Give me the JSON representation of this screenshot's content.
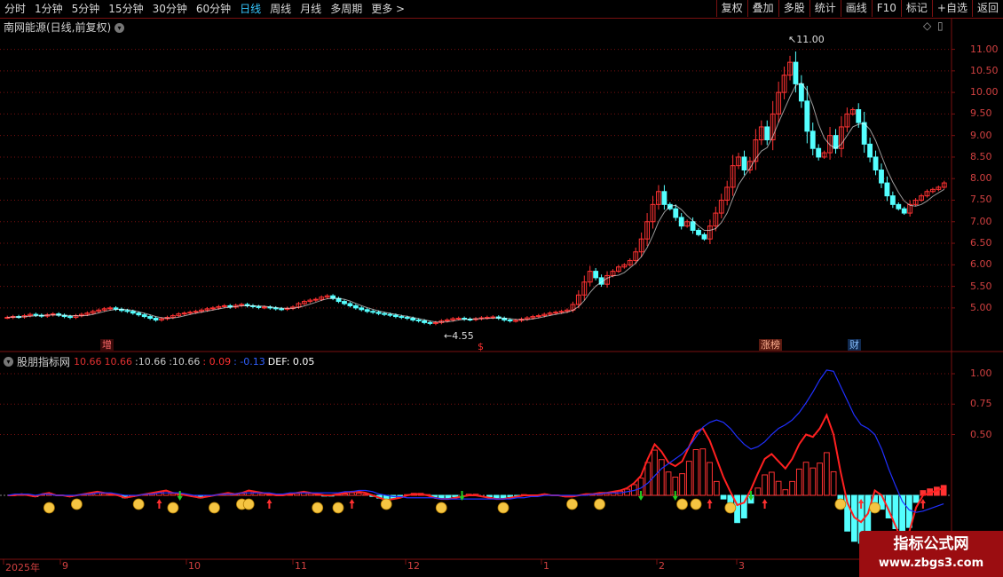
{
  "toolbar": {
    "periods": [
      "分时",
      "1分钟",
      "5分钟",
      "15分钟",
      "30分钟",
      "60分钟",
      "日线",
      "周线",
      "月线",
      "多周期",
      "更多 >"
    ],
    "active": "日线",
    "right": [
      "复权",
      "叠加",
      "多股",
      "统计",
      "画线",
      "F10",
      "标记",
      "+自选",
      "返回"
    ]
  },
  "main_panel": {
    "title": "南网能源(日线,前复权)",
    "high_label": "11.00",
    "low_label": "4.55",
    "tags": [
      {
        "text": "增",
        "color": "#ff5555"
      },
      {
        "text": "$",
        "color": "#ff3333"
      },
      {
        "text": "涨榜",
        "color": "#ff8a6a"
      },
      {
        "text": "财",
        "color": "#66aaff"
      }
    ]
  },
  "indicator_panel": {
    "title": "股朋指标网",
    "values": [
      "10.66",
      "10.66",
      ":10.66",
      ":10.66",
      ": 0.09",
      ": -0.13",
      "DEF: 0.05"
    ],
    "value_colors": [
      "#e03030",
      "#e03030",
      "#c8c8c8",
      "#c8c8c8",
      "#ff3030",
      "#3060ff",
      "#ffffff"
    ]
  },
  "watermark": {
    "title": "指标公式网",
    "url": "www.zbgs3.com"
  },
  "colors": {
    "up": "#ff3232",
    "down": "#54ffff",
    "grid": "#7a1010",
    "ma": "#ffffff"
  },
  "chart_data": [
    {
      "type": "candlestick",
      "title": "南网能源(日线,前复权)",
      "y_ticks": [
        11.0,
        10.5,
        10.0,
        9.5,
        9.0,
        8.5,
        8.0,
        7.5,
        7.0,
        6.5,
        6.0,
        5.5,
        5.0
      ],
      "ylim": [
        4.4,
        11.3
      ],
      "x_ticks": [
        "2025年",
        "9",
        "10",
        "11",
        "12",
        "1",
        "2",
        "3"
      ],
      "close": [
        4.78,
        4.8,
        4.79,
        4.82,
        4.85,
        4.83,
        4.81,
        4.84,
        4.86,
        4.83,
        4.8,
        4.78,
        4.82,
        4.85,
        4.88,
        4.92,
        4.95,
        4.98,
        5.0,
        4.97,
        4.94,
        4.92,
        4.88,
        4.84,
        4.8,
        4.76,
        4.72,
        4.75,
        4.78,
        4.82,
        4.86,
        4.88,
        4.9,
        4.92,
        4.95,
        4.98,
        5.0,
        5.03,
        5.05,
        5.02,
        5.06,
        5.08,
        5.05,
        5.03,
        5.01,
        5.02,
        5.0,
        4.98,
        4.97,
        4.99,
        5.02,
        5.1,
        5.15,
        5.18,
        5.2,
        5.25,
        5.28,
        5.22,
        5.15,
        5.1,
        5.05,
        5.0,
        4.96,
        4.92,
        4.9,
        4.87,
        4.85,
        4.83,
        4.8,
        4.78,
        4.76,
        4.72,
        4.7,
        4.66,
        4.64,
        4.66,
        4.7,
        4.72,
        4.75,
        4.76,
        4.74,
        4.73,
        4.75,
        4.77,
        4.78,
        4.79,
        4.76,
        4.72,
        4.7,
        4.71,
        4.74,
        4.77,
        4.8,
        4.82,
        4.85,
        4.88,
        4.9,
        4.92,
        4.95,
        5.08,
        5.3,
        5.6,
        5.85,
        5.7,
        5.55,
        5.75,
        5.85,
        5.95,
        6.0,
        6.1,
        6.3,
        6.6,
        7.0,
        7.4,
        7.7,
        7.4,
        7.3,
        7.1,
        6.9,
        7.0,
        6.8,
        6.7,
        6.6,
        6.9,
        7.2,
        7.5,
        7.8,
        8.3,
        8.5,
        8.2,
        8.4,
        8.9,
        9.2,
        8.9,
        9.5,
        10.0,
        10.4,
        10.7,
        10.2,
        9.8,
        9.1,
        8.7,
        8.5,
        8.6,
        9.0,
        8.7,
        9.2,
        9.5,
        9.6,
        9.3,
        8.8,
        8.5,
        8.2,
        7.9,
        7.6,
        7.4,
        7.3,
        7.2,
        7.4,
        7.5,
        7.6,
        7.7,
        7.75,
        7.8,
        7.9
      ]
    },
    {
      "type": "indicator",
      "title": "股朋指标网",
      "y_ticks": [
        1.0,
        0.75,
        0.5
      ],
      "series": [
        {
          "color": "#ff2020",
          "values": [
            0.0,
            0.0,
            0.01,
            0.0,
            -0.01,
            0.01,
            0.02,
            0.0,
            0.0,
            -0.01,
            0.0,
            0.01,
            0.02,
            0.03,
            0.02,
            0.01,
            0.0,
            -0.02,
            -0.01,
            0.0,
            0.01,
            0.02,
            0.03,
            0.04,
            0.02,
            0.01,
            0.0,
            -0.01,
            -0.02,
            -0.01,
            0.0,
            0.01,
            0.02,
            0.01,
            0.02,
            0.04,
            0.03,
            0.02,
            0.01,
            0.0,
            0.0,
            0.01,
            0.02,
            0.03,
            0.02,
            0.01,
            0.0,
            0.0,
            0.01,
            0.02,
            0.03,
            0.03,
            0.02,
            0.0,
            -0.02,
            -0.04,
            -0.03,
            -0.02,
            0.0,
            0.01,
            0.01,
            0.0,
            -0.02,
            -0.03,
            -0.03,
            -0.02,
            -0.01,
            0.0,
            0.0,
            -0.01,
            -0.02,
            -0.03,
            -0.03,
            -0.02,
            -0.01,
            0.0,
            0.0,
            0.0,
            0.01,
            0.0,
            0.0,
            -0.01,
            -0.01,
            0.0,
            0.01,
            0.01,
            0.02,
            0.02,
            0.03,
            0.04,
            0.06,
            0.1,
            0.16,
            0.3,
            0.42,
            0.36,
            0.27,
            0.24,
            0.28,
            0.4,
            0.52,
            0.55,
            0.45,
            0.3,
            0.15,
            0.03,
            -0.08,
            -0.06,
            0.05,
            0.18,
            0.3,
            0.34,
            0.28,
            0.22,
            0.3,
            0.42,
            0.5,
            0.48,
            0.55,
            0.66,
            0.5,
            0.2,
            -0.06,
            -0.18,
            -0.22,
            -0.15,
            0.04,
            0.0,
            -0.12,
            -0.25,
            -0.38,
            -0.3,
            -0.1,
            0.0,
            0.02,
            0.04,
            0.06
          ]
        },
        {
          "color": "#2030ff",
          "values": [
            0.0,
            0.01,
            0.01,
            0.01,
            0.0,
            0.01,
            0.01,
            0.0,
            0.0,
            0.0,
            0.0,
            0.01,
            0.01,
            0.02,
            0.02,
            0.02,
            0.01,
            0.0,
            0.0,
            0.0,
            0.01,
            0.01,
            0.02,
            0.02,
            0.02,
            0.02,
            0.01,
            0.0,
            0.0,
            0.0,
            0.0,
            0.01,
            0.01,
            0.01,
            0.02,
            0.02,
            0.02,
            0.02,
            0.02,
            0.01,
            0.01,
            0.02,
            0.02,
            0.02,
            0.02,
            0.02,
            0.02,
            0.02,
            0.02,
            0.03,
            0.03,
            0.04,
            0.04,
            0.03,
            0.01,
            0.0,
            -0.01,
            -0.01,
            -0.02,
            -0.02,
            -0.02,
            -0.02,
            -0.02,
            -0.03,
            -0.03,
            -0.03,
            -0.03,
            -0.03,
            -0.03,
            -0.03,
            -0.03,
            -0.03,
            -0.03,
            -0.03,
            -0.02,
            -0.02,
            -0.01,
            -0.01,
            0.0,
            0.0,
            0.0,
            0.0,
            0.0,
            0.0,
            0.0,
            0.01,
            0.01,
            0.02,
            0.02,
            0.02,
            0.03,
            0.04,
            0.06,
            0.1,
            0.16,
            0.22,
            0.26,
            0.3,
            0.34,
            0.4,
            0.48,
            0.56,
            0.6,
            0.62,
            0.6,
            0.55,
            0.48,
            0.42,
            0.38,
            0.4,
            0.44,
            0.5,
            0.55,
            0.58,
            0.62,
            0.68,
            0.76,
            0.85,
            0.95,
            1.03,
            1.02,
            0.9,
            0.78,
            0.66,
            0.58,
            0.55,
            0.5,
            0.38,
            0.22,
            0.08,
            -0.05,
            -0.12,
            -0.14,
            -0.13,
            -0.11,
            -0.09,
            -0.07
          ]
        }
      ]
    }
  ]
}
